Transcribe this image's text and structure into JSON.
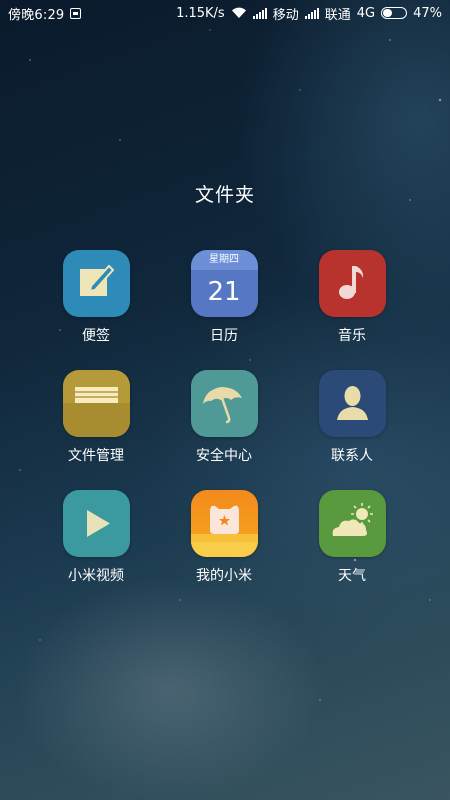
{
  "status_bar": {
    "time": "傍晚6:29",
    "speed": "1.15K/s",
    "carrier1": "移动",
    "carrier2": "联通",
    "network": "4G",
    "battery": "47%",
    "battery_level": 0.47
  },
  "folder": {
    "title": "文件夹",
    "apps": [
      {
        "label": "便签",
        "icon": "notes-icon",
        "color": "#2e8bb8"
      },
      {
        "label": "日历",
        "icon": "calendar-icon",
        "color": "#5577c4",
        "weekday": "星期四",
        "day": "21"
      },
      {
        "label": "音乐",
        "icon": "music-icon",
        "color": "#b8332e"
      },
      {
        "label": "文件管理",
        "icon": "folder-icon",
        "color": "#b59a3a"
      },
      {
        "label": "安全中心",
        "icon": "umbrella-icon",
        "color": "#4f9a96"
      },
      {
        "label": "联系人",
        "icon": "contact-icon",
        "color": "#2c4a78"
      },
      {
        "label": "小米视频",
        "icon": "video-play-icon",
        "color": "#3a9aa0"
      },
      {
        "label": "我的小米",
        "icon": "mi-bear-icon",
        "color": "#f59a1e"
      },
      {
        "label": "天气",
        "icon": "weather-icon",
        "color": "#5a9a3e"
      }
    ]
  }
}
